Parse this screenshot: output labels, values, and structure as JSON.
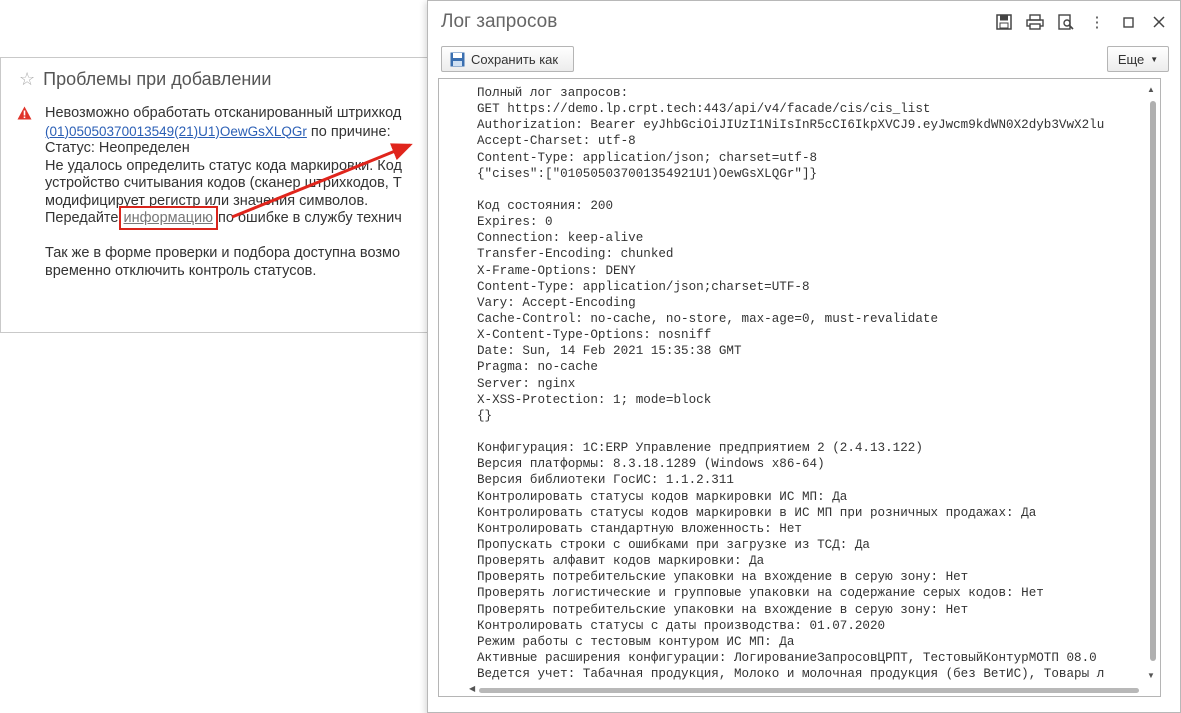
{
  "background_dialog": {
    "title": "Проблемы при добавлении",
    "lines": [
      "Невозможно обработать отсканированный штрихкод",
      "Статус: Неопределен",
      "Не удалось определить статус кода маркировки. Код",
      "устройство считывания кодов (сканер штрихкодов, Т",
      "модифицирует регистр или значения символов.",
      "Так же в форме проверки и подбора доступна возмо",
      "временно отключить контроль статусов."
    ],
    "barcode_link": "(01)05050370013549(21)U1)OewGsXLQGr",
    "reason_suffix": " по причине:",
    "transfer_prefix": "Передайте ",
    "info_link": "информацию",
    "transfer_suffix": " по ошибке в службу технич"
  },
  "window": {
    "title": "Лог запросов",
    "save_button": "Сохранить как",
    "more_button": "Еще",
    "log_lines": [
      "Полный лог запросов:",
      "GET https://demo.lp.crpt.tech:443/api/v4/facade/cis/cis_list",
      "Authorization: Bearer eyJhbGciOiJIUzI1NiIsInR5cCI6IkpXVCJ9.eyJwcm9kdWN0X2dyb3VwX2lu",
      "Accept-Charset: utf-8",
      "Content-Type: application/json; charset=utf-8",
      "{\"cises\":[\"010505037001354921U1)OewGsXLQGr\"]}",
      "",
      "Код состояния: 200",
      "Expires: 0",
      "Connection: keep-alive",
      "Transfer-Encoding: chunked",
      "X-Frame-Options: DENY",
      "Content-Type: application/json;charset=UTF-8",
      "Vary: Accept-Encoding",
      "Cache-Control: no-cache, no-store, max-age=0, must-revalidate",
      "X-Content-Type-Options: nosniff",
      "Date: Sun, 14 Feb 2021 15:35:38 GMT",
      "Pragma: no-cache",
      "Server: nginx",
      "X-XSS-Protection: 1; mode=block",
      "{}",
      "",
      "Конфигурация: 1С:ERP Управление предприятием 2 (2.4.13.122)",
      "Версия платформы: 8.3.18.1289 (Windows x86-64)",
      "Версия библиотеки ГосИС: 1.1.2.311",
      "Контролировать статусы кодов маркировки ИС МП: Да",
      "Контролировать статусы кодов маркировки в ИС МП при розничных продажах: Да",
      "Контролировать стандартную вложенность: Нет",
      "Пропускать строки с ошибками при загрузке из ТСД: Да",
      "Проверять алфавит кодов маркировки: Да",
      "Проверять потребительские упаковки на вхождение в серую зону: Нет",
      "Проверять логистические и групповые упаковки на содержание серых кодов: Нет",
      "Проверять потребительские упаковки на вхождение в серую зону: Нет",
      "Контролировать статусы с даты производства: 01.07.2020",
      "Режим работы с тестовым контуром ИС МП: Да",
      "Активные расширения конфигурации: ЛогированиеЗапросовЦРПТ, ТестовыйКонтурМОТП 08.0",
      "Ведется учет: Табачная продукция, Молоко и молочная продукция (без ВетИС), Товары л"
    ]
  },
  "colors": {
    "warning": "#e0342a",
    "link": "#2b5fb5",
    "highlight": "#d9251c"
  },
  "icons": [
    "star-icon",
    "warning-icon",
    "save-icon",
    "print-icon",
    "preview-icon",
    "menu-icon",
    "minimize-icon",
    "close-icon"
  ]
}
